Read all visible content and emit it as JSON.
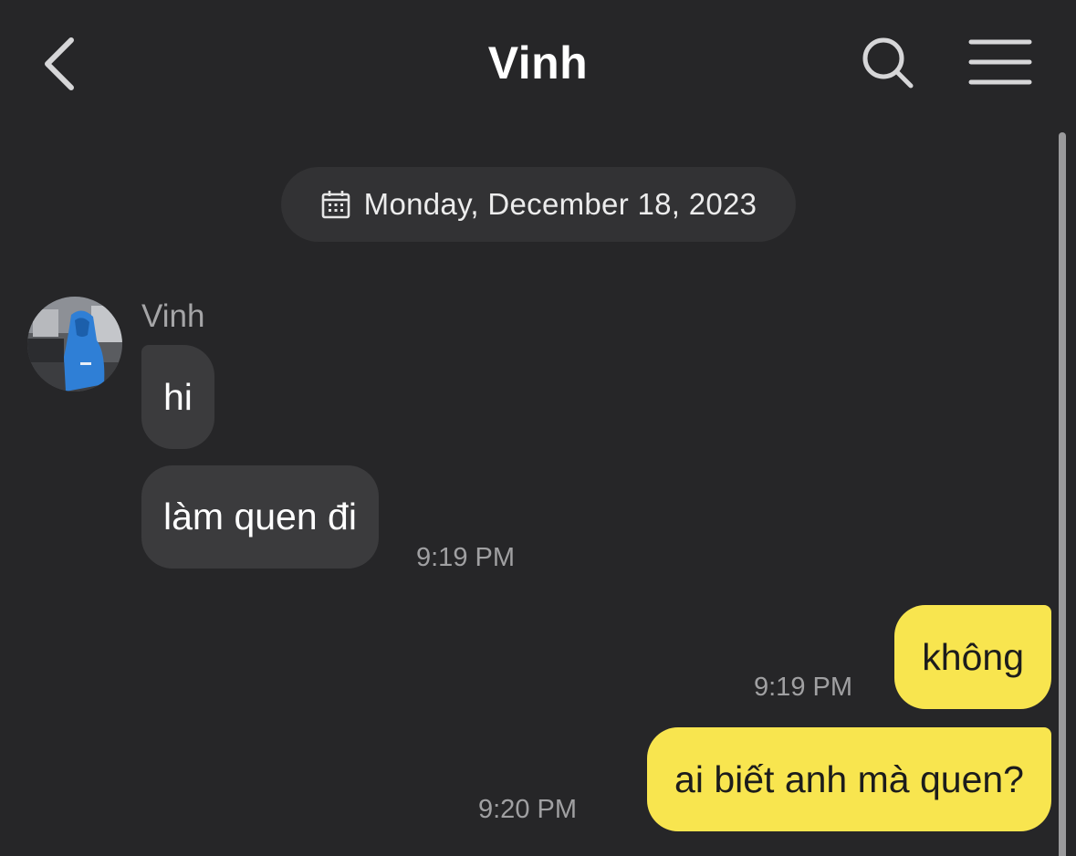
{
  "header": {
    "title": "Vinh",
    "back_icon": "chevron-left-icon",
    "search_icon": "search-icon",
    "menu_icon": "hamburger-menu-icon"
  },
  "date_divider": {
    "icon": "calendar-icon",
    "label": "Monday, December 18, 2023"
  },
  "messages": [
    {
      "direction": "incoming",
      "sender": "Vinh",
      "text": "hi"
    },
    {
      "direction": "incoming",
      "text": "làm quen đi",
      "time": "9:19 PM"
    },
    {
      "direction": "outgoing",
      "text": "không",
      "time": "9:19 PM"
    },
    {
      "direction": "outgoing",
      "text": "ai biết anh mà quen?",
      "time": "9:20 PM"
    }
  ],
  "colors": {
    "background": "#262628",
    "incoming_bubble": "#3b3b3d",
    "outgoing_bubble": "#f8e54f",
    "secondary_text": "#a0a0a2"
  }
}
